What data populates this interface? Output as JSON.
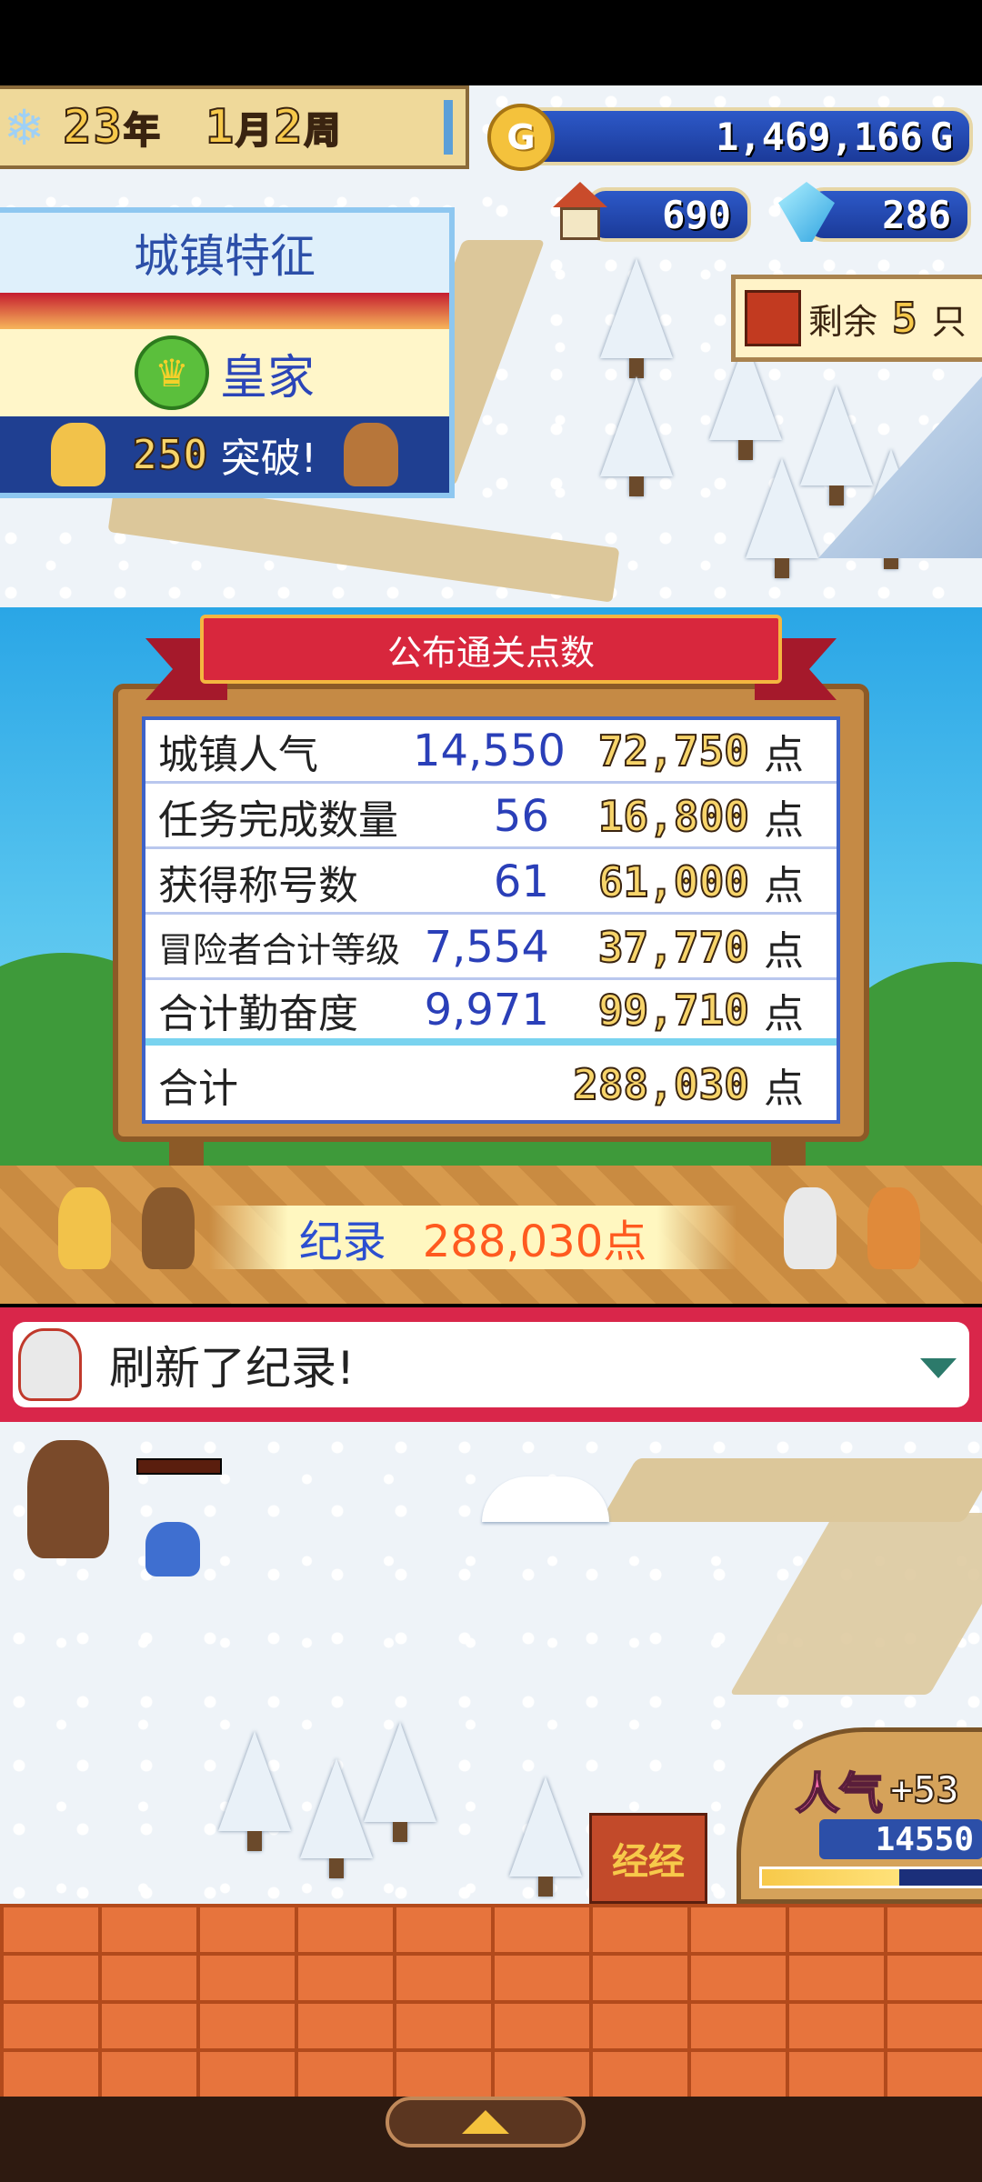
{
  "hud": {
    "date": {
      "year": "23",
      "year_unit": "年",
      "month": "1",
      "month_unit": "月",
      "week": "2",
      "week_unit": "周"
    },
    "gold": "1,469,166",
    "gold_unit": "G",
    "gold_coin_letter": "G",
    "houses": "690",
    "crystals": "286",
    "enemy_remaining_prefix": "剩余",
    "enemy_remaining_count": "5",
    "enemy_remaining_unit": "只"
  },
  "trait_panel": {
    "title": "城镇特征",
    "trait_name": "皇家",
    "milestone_number": "250",
    "milestone_text": "突破!"
  },
  "score_board": {
    "title": "公布通关点数",
    "rows": [
      {
        "label": "城镇人气",
        "count": "14,550",
        "points": "72,750",
        "unit": "点"
      },
      {
        "label": "任务完成数量",
        "count": "56",
        "points": "16,800",
        "unit": "点"
      },
      {
        "label": "获得称号数",
        "count": "61",
        "points": "61,000",
        "unit": "点"
      },
      {
        "label": "冒险者合计等级",
        "count": "7,554",
        "points": "37,770",
        "unit": "点"
      },
      {
        "label": "合计勤奋度",
        "count": "9,971",
        "points": "99,710",
        "unit": "点"
      }
    ],
    "total_label": "合计",
    "total_points": "288,030",
    "total_unit": "点"
  },
  "record": {
    "label": "纪录",
    "value": "288,030点"
  },
  "message": {
    "text": "刷新了纪录!"
  },
  "popularity": {
    "label": "人气",
    "delta": "+53",
    "value": "14550",
    "fill_ratio": 0.62
  },
  "shop_sign": "经经",
  "colors": {
    "accent_red": "#d8273d",
    "board_blue": "#2c5eb8",
    "gold": "#f4c23c",
    "points_orange": "#ff5a1f"
  },
  "icons": [
    "snowflake-icon",
    "gold-coin-icon",
    "house-icon",
    "crystal-icon",
    "crown-icon",
    "enemy-portrait-icon",
    "dropdown-arrow-icon",
    "up-arrow-icon"
  ]
}
